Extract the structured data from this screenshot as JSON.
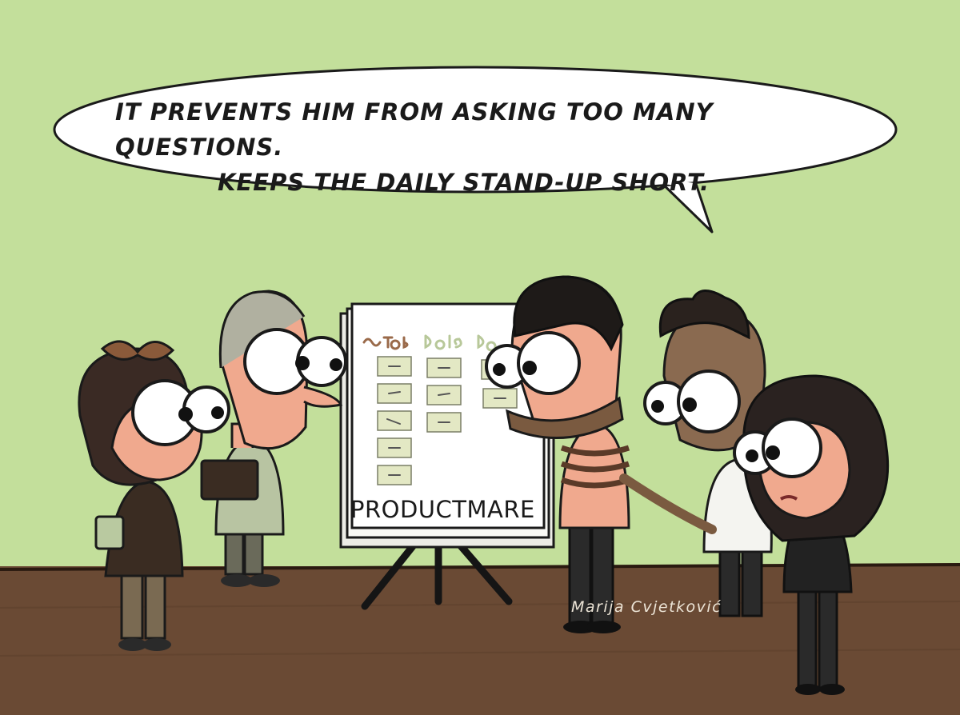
{
  "speech_bubble": {
    "line1": "IT PREVENTS HIM FROM ASKING TOO MANY QUESTIONS.",
    "line2": "KEEPS THE DAILY STAND-UP SHORT."
  },
  "flipchart": {
    "label": "PRODUCTMARE"
  },
  "signature": "Marija Cvjetković",
  "colors": {
    "wall": "#c3df9b",
    "floor": "#6a4a34",
    "bubble": "#ffffff",
    "sticky_note": "#e3e8c4",
    "skin": "#f0a98e",
    "outline": "#1a1a1a"
  }
}
